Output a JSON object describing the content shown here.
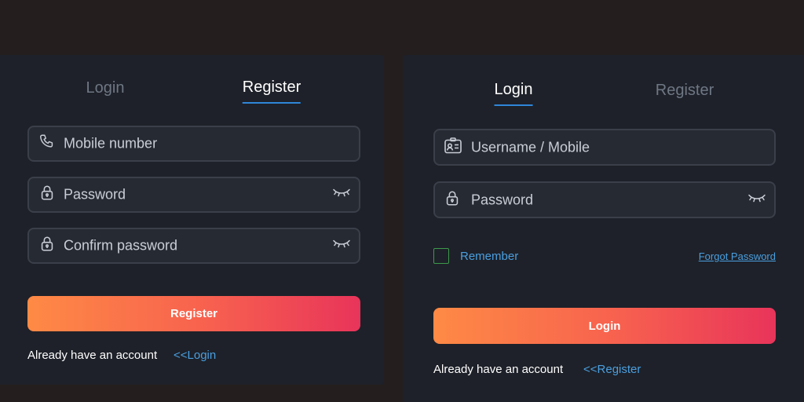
{
  "register_panel": {
    "tabs": {
      "login": "Login",
      "register": "Register"
    },
    "fields": {
      "mobile_placeholder": "Mobile number",
      "password_placeholder": "Password",
      "confirm_placeholder": "Confirm password"
    },
    "submit_label": "Register",
    "footer_text": "Already have an account",
    "footer_link": "<<Login"
  },
  "login_panel": {
    "tabs": {
      "login": "Login",
      "register": "Register"
    },
    "fields": {
      "username_placeholder": "Username / Mobile",
      "password_placeholder": "Password"
    },
    "remember_label": "Remember",
    "forgot_label": "Forgot Password",
    "submit_label": "Login",
    "footer_text": "Already have an account",
    "footer_link": "<<Register"
  },
  "colors": {
    "page_bg": "#241f1e",
    "panel_bg": "#1e2129",
    "accent_blue": "#2f86d8",
    "link_blue": "#4a9fe0",
    "button_gradient_start": "#fe8a45",
    "button_gradient_end": "#e8345a",
    "checkbox_green": "#3d9a4c"
  },
  "icons": [
    "phone-icon",
    "lock-icon",
    "eye-closed-icon",
    "id-card-icon"
  ]
}
